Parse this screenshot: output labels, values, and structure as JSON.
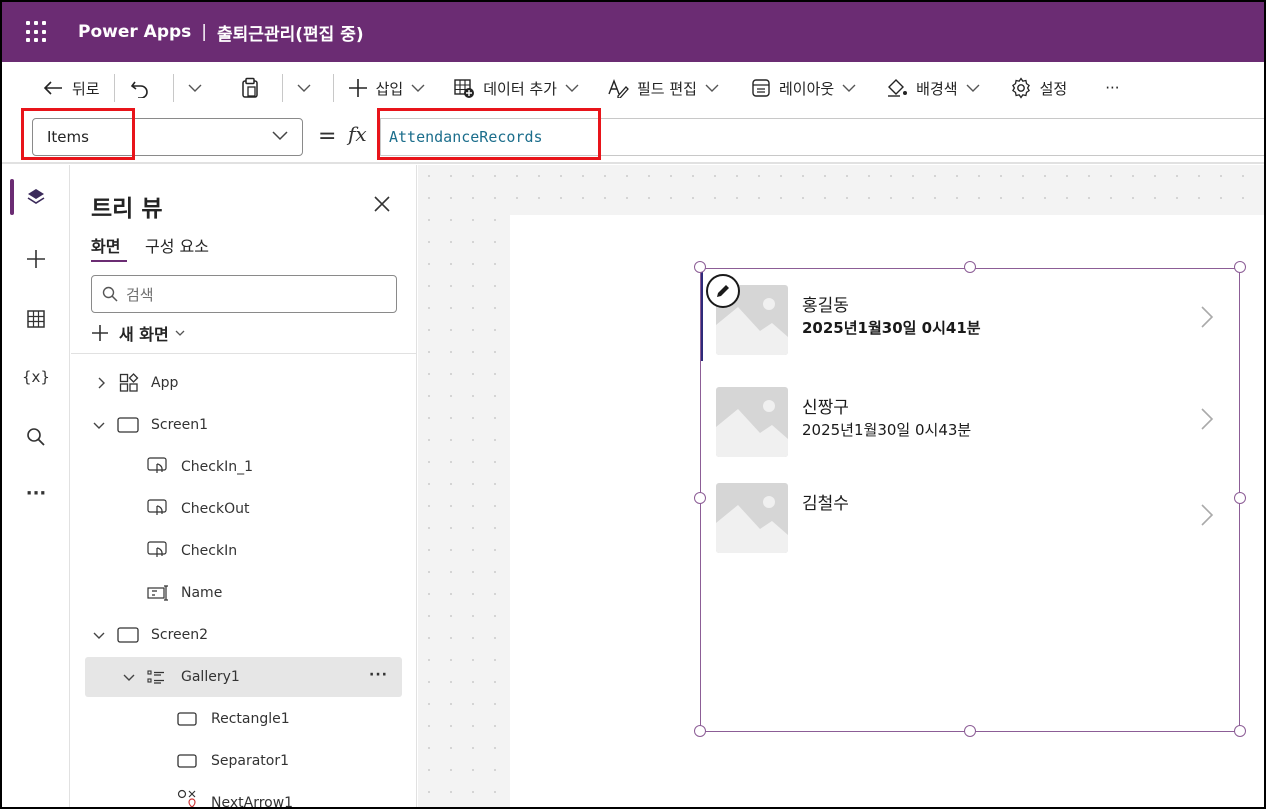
{
  "header": {
    "app_name": "Power Apps",
    "separator": "|",
    "app_title": "출퇴근관리(편집 중)",
    "bg_color": "#6b2c73"
  },
  "commandbar": {
    "back_label": "뒤로",
    "insert_label": "삽입",
    "add_data_label": "데이터 추가",
    "edit_fields_label": "필드 편집",
    "layout_label": "레이아웃",
    "background_label": "배경색",
    "settings_label": "설정",
    "more_label": "···",
    "icons": [
      "back-arrow-icon",
      "undo-icon",
      "clipboard-icon",
      "plus-icon",
      "add-data-icon",
      "edit-fields-icon",
      "layout-icon",
      "background-color-icon",
      "gear-icon"
    ]
  },
  "formula": {
    "property": "Items",
    "equals": "=",
    "fx": "fx",
    "value": "AttendanceRecords"
  },
  "treeview": {
    "title": "트리 뷰",
    "tabs": [
      {
        "label": "화면",
        "active": true
      },
      {
        "label": "구성 요소",
        "active": false
      }
    ],
    "search_placeholder": "검색",
    "new_screen_label": "새 화면",
    "nodes": [
      {
        "label": "App",
        "icon": "app-icon",
        "expander": "collapsed"
      },
      {
        "label": "Screen1",
        "icon": "screen-icon",
        "expander": "expanded"
      },
      {
        "label": "CheckIn_1",
        "icon": "button-icon"
      },
      {
        "label": "CheckOut",
        "icon": "button-icon"
      },
      {
        "label": "CheckIn",
        "icon": "button-icon"
      },
      {
        "label": "Name",
        "icon": "text-input-icon"
      },
      {
        "label": "Screen2",
        "icon": "screen-icon",
        "expander": "expanded"
      },
      {
        "label": "Gallery1",
        "icon": "gallery-icon",
        "expander": "expanded",
        "selected": true,
        "more": "···"
      },
      {
        "label": "Rectangle1",
        "icon": "rectangle-icon"
      },
      {
        "label": "Separator1",
        "icon": "rectangle-icon"
      },
      {
        "label": "NextArrow1",
        "icon": "icon-control-icon"
      }
    ]
  },
  "gallery": {
    "rows": [
      {
        "name": "홍길동",
        "time": "2025년1월30일 0시41분",
        "time_bold": true
      },
      {
        "name": "신짱구",
        "time": "2025년1월30일 0시43분",
        "time_bold": false
      },
      {
        "name": "김철수",
        "time": "",
        "time_bold": false
      }
    ]
  },
  "colors": {
    "accent": "#6b2c73",
    "selection_frame": "#8c5d96",
    "highlight_box": "#e8141a",
    "formula_text": "#1c6e8c"
  }
}
